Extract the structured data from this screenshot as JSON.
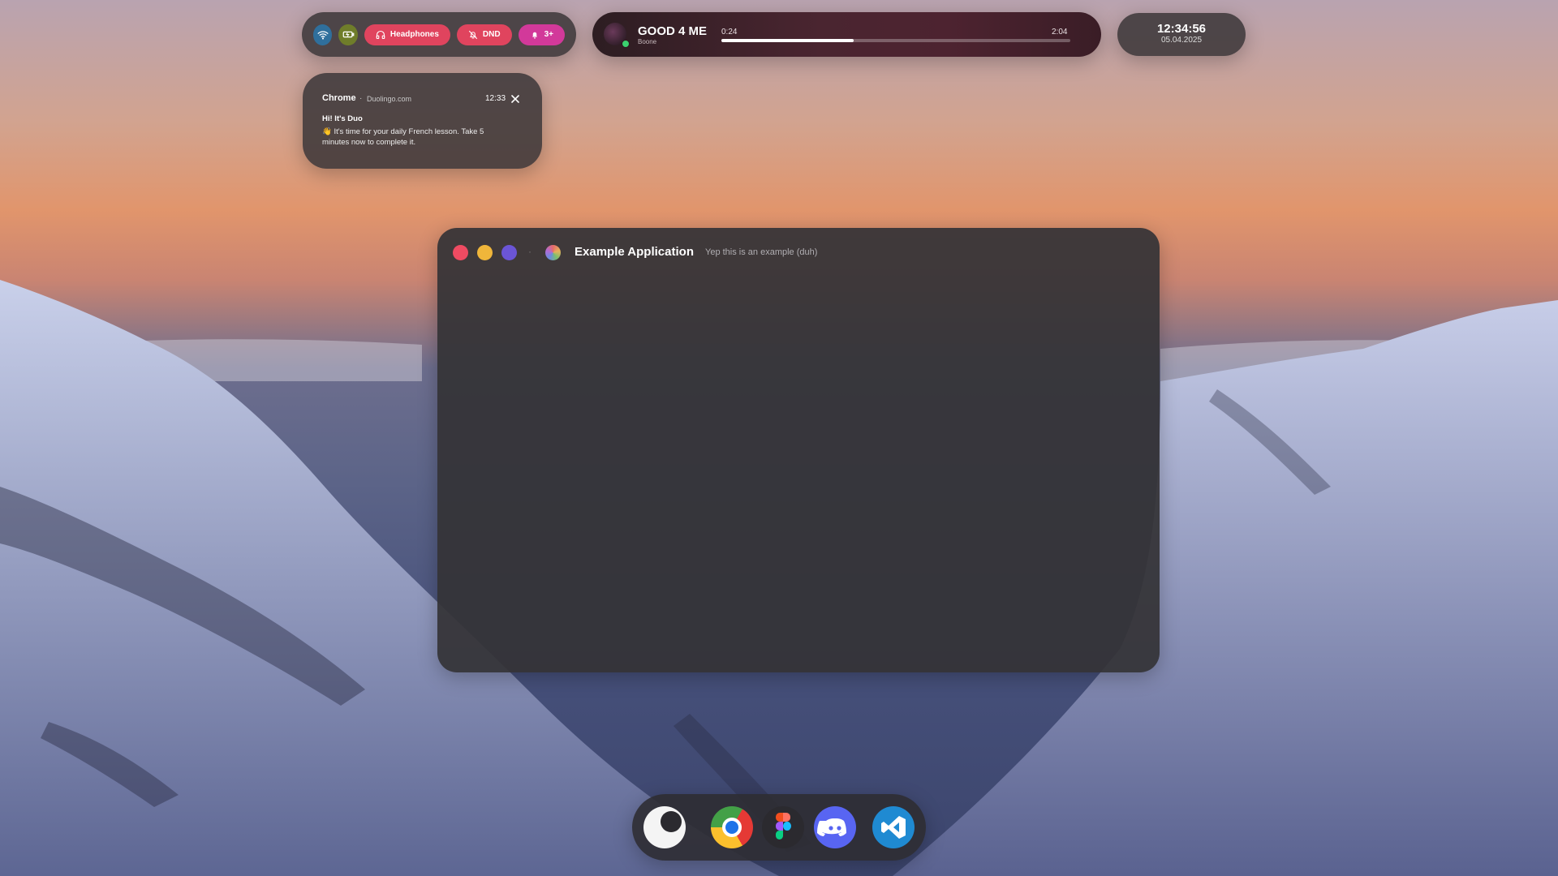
{
  "topbar": {
    "toggles": {
      "wifi_icon": "wifi-icon",
      "battery_icon": "battery-icon",
      "headphones_label": "Headphones",
      "dnd_label": "DND",
      "notifications_label": "3+",
      "colors": {
        "wifi": "#2f6f9c",
        "battery": "#6f7d2a",
        "headphones": "#e0445e",
        "dnd": "#e0445e",
        "notifications": "#d2399a"
      }
    },
    "media": {
      "title": "GOOD 4 ME",
      "artist": "Boone",
      "current_time": "0:24",
      "total_time": "2:04",
      "progress": 0.38
    },
    "clock": {
      "time": "12:34:56",
      "date": "05.04.2025"
    }
  },
  "notification": {
    "app": "Chrome",
    "separator": "·",
    "source": "Duolingo.com",
    "time": "12:33",
    "title": "Hi! It's Duo",
    "body": "👋 It's time for your daily French lesson. Take 5 minutes now to complete it."
  },
  "window": {
    "title": "Example Application",
    "subtitle": "Yep this is an example (duh)",
    "separator": "·",
    "traffic_lights": {
      "close": "#ef4b62",
      "minimize": "#f0b63a",
      "maximize": "#6b55d6"
    }
  },
  "dock": {
    "items": [
      "launcher-icon",
      "chrome-icon",
      "figma-icon",
      "discord-icon",
      "vscode-icon"
    ]
  }
}
